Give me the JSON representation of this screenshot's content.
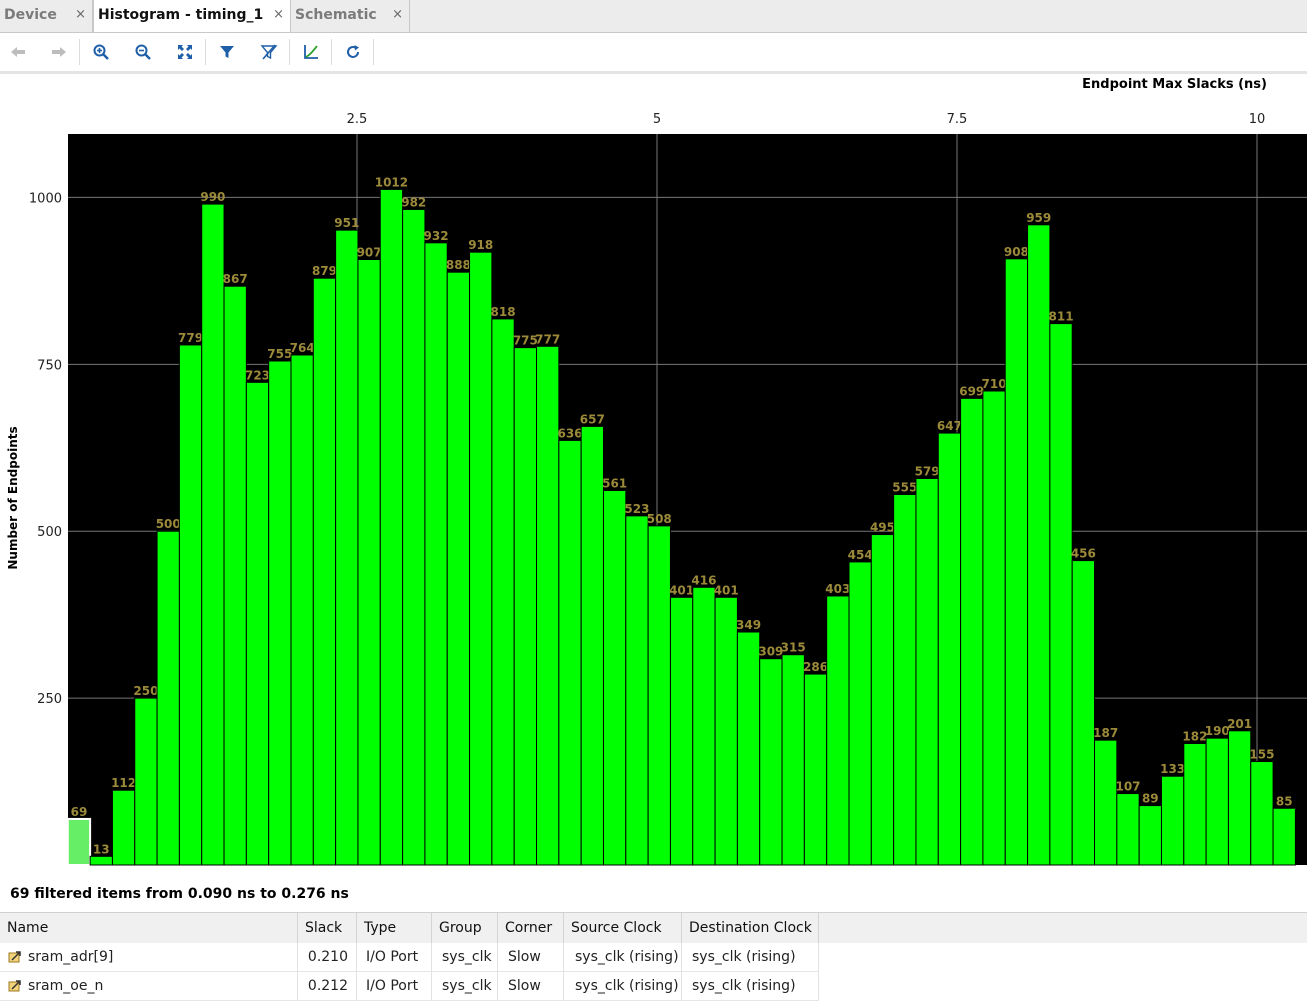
{
  "tabs": [
    {
      "label": "Device",
      "active": false
    },
    {
      "label": "Histogram - timing_1",
      "active": true
    },
    {
      "label": "Schematic",
      "active": false
    }
  ],
  "tab_close_glyph": "×",
  "toolbar": {
    "buttons": [
      "back-icon",
      "forward-icon",
      "zoom-in-icon",
      "zoom-out-icon",
      "fit-icon",
      "filter-icon",
      "clear-filter-icon",
      "chart-icon",
      "refresh-icon"
    ]
  },
  "colors": {
    "bar": "#00ff00",
    "bar_selected": "#66ee66",
    "label": "#9b8a3a",
    "plot_bg": "#000000",
    "grid": "#777777"
  },
  "chart_data": {
    "type": "bar",
    "title": "Endpoint Max Slacks (ns)",
    "xlabel": "Endpoint Max Slacks (ns)",
    "ylabel": "Number of Endpoints",
    "x_ticks": [
      "2.5",
      "5",
      "7.5",
      "10"
    ],
    "x_tick_values": [
      2.5,
      5,
      7.5,
      10
    ],
    "y_ticks": [
      "250",
      "500",
      "750",
      "1000"
    ],
    "y_tick_values": [
      250,
      500,
      750,
      1000
    ],
    "ylim": [
      0,
      1095
    ],
    "bin_start": 0.09,
    "bin_width": 0.186,
    "values": [
      69,
      13,
      112,
      250,
      500,
      779,
      990,
      867,
      723,
      755,
      764,
      879,
      951,
      907,
      1012,
      982,
      932,
      888,
      918,
      818,
      775,
      777,
      636,
      657,
      561,
      523,
      508,
      401,
      416,
      401,
      349,
      309,
      315,
      286,
      403,
      454,
      495,
      555,
      579,
      647,
      699,
      710,
      908,
      959,
      811,
      456,
      187,
      107,
      89,
      133,
      182,
      190,
      201,
      155,
      85
    ],
    "selected_bin": 0,
    "grid": true
  },
  "filter_info": "69 filtered items from 0.090 ns to 0.276 ns",
  "table": {
    "columns": [
      "Name",
      "Slack",
      "Type",
      "Group",
      "Corner",
      "Source Clock",
      "Destination Clock"
    ],
    "rows": [
      [
        "sram_adr[9]",
        "0.210",
        "I/O Port",
        "sys_clk",
        "Slow",
        "sys_clk (rising)",
        "sys_clk (rising)"
      ],
      [
        "sram_oe_n",
        "0.212",
        "I/O Port",
        "sys_clk",
        "Slow",
        "sys_clk (rising)",
        "sys_clk (rising)"
      ]
    ]
  }
}
